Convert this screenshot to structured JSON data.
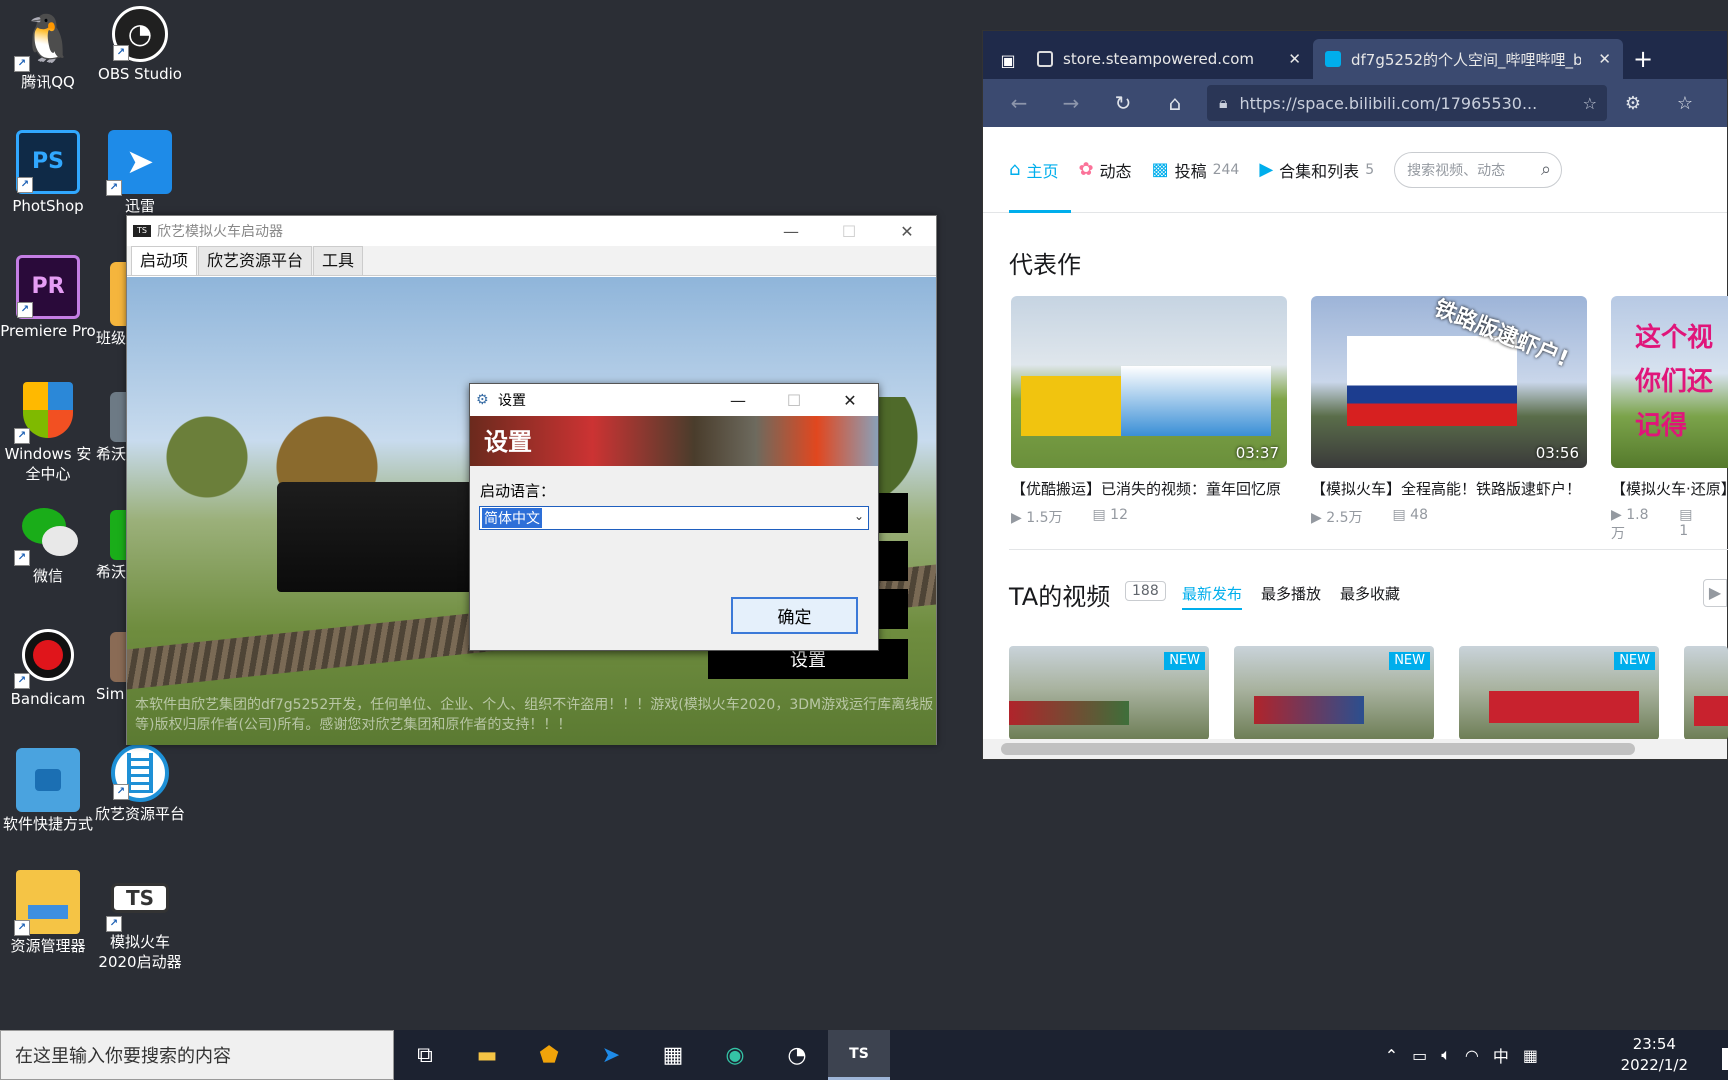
{
  "desktop": {
    "icons": [
      {
        "label": "腾讯QQ",
        "icon": "qq-icon"
      },
      {
        "label": "OBS Studio",
        "icon": "obs-icon"
      },
      {
        "label": "PhotShop",
        "icon": "photoshop-icon",
        "glyph": "PS"
      },
      {
        "label": "迅雷",
        "icon": "xunlei-icon"
      },
      {
        "label": "Premiere Pro",
        "icon": "premiere-icon",
        "glyph": "PR"
      },
      {
        "label": "班级",
        "icon": "folder-icon"
      },
      {
        "label": "Windows 安全中心",
        "icon": "windows-security-icon"
      },
      {
        "label": "希沃",
        "icon": "seewo-icon"
      },
      {
        "label": "微信",
        "icon": "wechat-icon"
      },
      {
        "label": "希沃",
        "icon": "seewo-icon"
      },
      {
        "label": "Bandicam",
        "icon": "bandicam-icon"
      },
      {
        "label": "Sim",
        "icon": "app-icon"
      },
      {
        "label": "软件快捷方式",
        "icon": "folder-icon"
      },
      {
        "label": "欣艺资源平台",
        "icon": "xinyi-icon"
      },
      {
        "label": "资源管理器",
        "icon": "explorer-icon"
      },
      {
        "label": "模拟火车 2020启动器",
        "icon": "ts-launcher-icon",
        "glyph": "TS"
      }
    ]
  },
  "launcher": {
    "title": "欣艺模拟火车启动器",
    "tabs": [
      "启动项",
      "欣艺资源平台",
      "工具"
    ],
    "settings_button": "设置",
    "disclaimer": "本软件由欣艺集团的df7g5252开发，任何单位、企业、个人、组织不许盗用！！！游戏(模拟火车2020，3DM游戏运行库离线版等)版权归原作者(公司)所有。感谢您对欣艺集团和原作者的支持！！！"
  },
  "dialog": {
    "title": "设置",
    "banner_text": "设置",
    "language_label": "启动语言：",
    "language_value": "简体中文",
    "ok_button": "确定"
  },
  "browser": {
    "tabs": [
      {
        "title": "store.steampowered.com"
      },
      {
        "title": "df7g5252的个人空间_哔哩哔哩_b"
      }
    ],
    "url": "https://space.bilibili.com/17965530...",
    "nav": [
      {
        "label": "主页",
        "count": ""
      },
      {
        "label": "动态",
        "count": ""
      },
      {
        "label": "投稿",
        "count": "244"
      },
      {
        "label": "合集和列表",
        "count": "5"
      }
    ],
    "search_placeholder": "搜索视频、动态",
    "featured_title": "代表作",
    "featured": [
      {
        "title": "【优酷搬运】已消失的视频：童年回忆原",
        "duration": "03:37",
        "plays": "1.5万",
        "danmaku": "12"
      },
      {
        "title": "【模拟火车】全程高能！铁路版逮虾户！",
        "duration": "03:56",
        "plays": "2.5万",
        "danmaku": "48",
        "overlay": "铁路版逮虾户!"
      },
      {
        "title": "【模拟火车·还原】",
        "duration": "",
        "plays": "1.8万",
        "danmaku": "1",
        "overlay": "这个视 你们还记得"
      }
    ],
    "videos_title": "TA的视频",
    "videos_count": "188",
    "video_tabs": [
      "最新发布",
      "最多播放",
      "最多收藏"
    ],
    "new_badge": "NEW"
  },
  "taskbar": {
    "search_placeholder": "在这里输入你要搜索的内容",
    "ime": "中",
    "time": "23:54",
    "date": "2022/1/2"
  }
}
